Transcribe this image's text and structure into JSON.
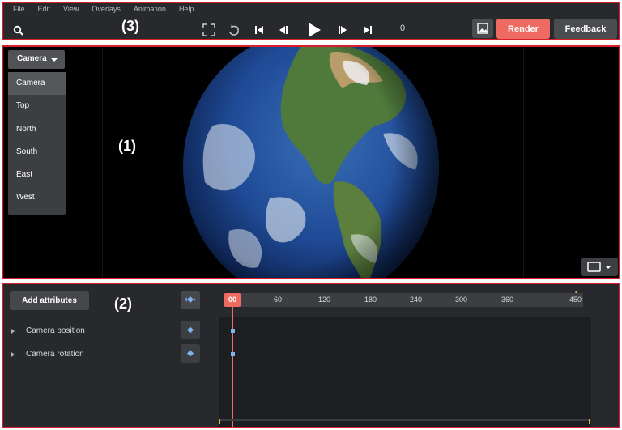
{
  "menu": [
    "File",
    "Edit",
    "View",
    "Overlays",
    "Animation",
    "Help"
  ],
  "annotations": {
    "top": "(3)",
    "viewport": "(1)",
    "timeline": "(2)"
  },
  "toolbar": {
    "frame": "0",
    "render_label": "Render",
    "feedback_label": "Feedback",
    "icons": [
      "search-icon",
      "fullscreen-icon",
      "loop-icon",
      "skip-to-start-icon",
      "step-back-icon",
      "play-icon",
      "step-forward-icon",
      "skip-to-end-icon",
      "image-icon"
    ]
  },
  "viewport": {
    "camera_select": "Camera",
    "camera_options": [
      "Camera",
      "Top",
      "North",
      "South",
      "East",
      "West"
    ],
    "selected_option": "Camera"
  },
  "timeline": {
    "add_attributes_label": "Add attributes",
    "current_frame": "00",
    "ticks": [
      "60",
      "120",
      "180",
      "240",
      "300",
      "360",
      "450"
    ],
    "attributes": [
      "Camera position",
      "Camera rotation"
    ]
  },
  "colors": {
    "accent": "#ee6b62",
    "panel": "#28292c",
    "annotation_border": "#d91f2b",
    "keyframe": "#7db4f0"
  }
}
